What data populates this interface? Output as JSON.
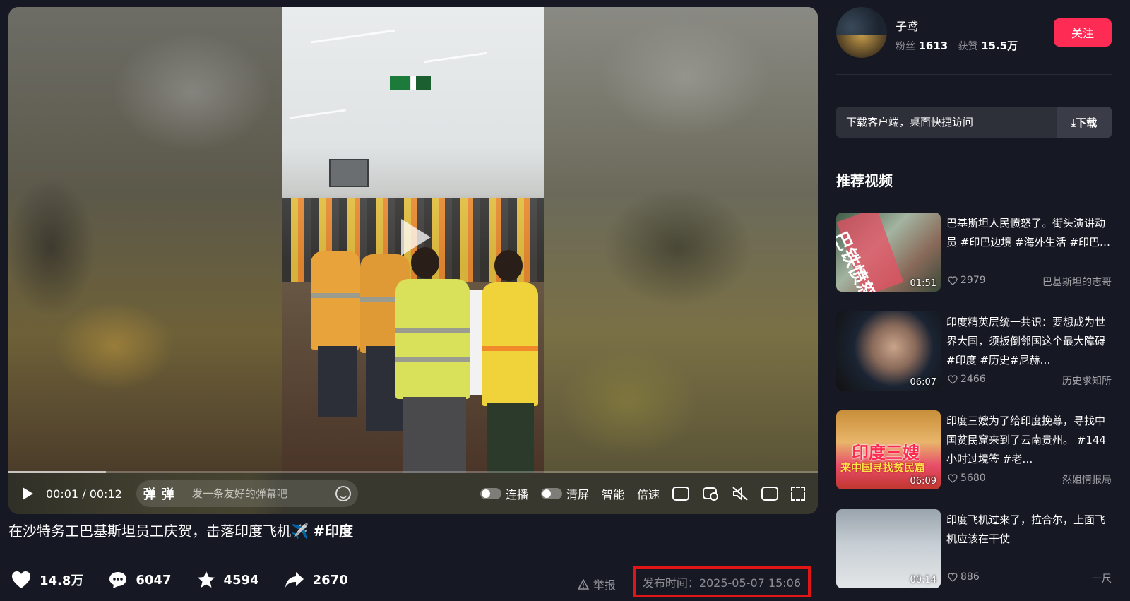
{
  "player": {
    "current_time": "00:01",
    "time_sep": "/",
    "duration": "00:12",
    "progress": 0.12,
    "danmaku_placeholder": "发一条友好的弹幕吧",
    "danmaku_icon_1": "弹",
    "danmaku_icon_2": "弹",
    "controls": {
      "autoplay_label": "连播",
      "clear_label": "清屏",
      "smart_label": "智能",
      "speed_label": "倍速"
    }
  },
  "video": {
    "title": "在沙特务工巴基斯坦员工庆贺，击落印度飞机✈️",
    "hashtag": "#印度",
    "likes": "14.8万",
    "comments": "6047",
    "favorites": "4594",
    "shares": "2670",
    "report_label": "举报",
    "publish_time": "发布时间：2025-05-07 15:06"
  },
  "author": {
    "name": "子鸢",
    "fans_label": "粉丝",
    "fans": "1613",
    "likes_label": "获赞",
    "likes": "15.5万",
    "follow_label": "关注"
  },
  "download": {
    "text": "下载客户端，桌面快捷访问",
    "button": "⤓下载"
  },
  "recommend": {
    "title": "推荐视频",
    "items": [
      {
        "title": "巴基斯坦人民愤怒了。街头演讲动员 #印巴边境 #海外生活 #印巴…",
        "duration": "01:51",
        "likes": "2979",
        "author": "巴基斯坦的志哥",
        "thumb_text": "巴铁愤怒"
      },
      {
        "title": "印度精英层统一共识：要想成为世界大国，须扳倒邻国这个最大障碍 #印度 #历史#尼赫…",
        "duration": "06:07",
        "likes": "2466",
        "author": "历史求知所"
      },
      {
        "title": "印度三嫂为了给印度挽尊，寻找中国贫民窟来到了云南贵州。 #144小时过境签 #老…",
        "duration": "06:09",
        "likes": "5680",
        "author": "然姐情报局",
        "thumb_text": "印度三嫂",
        "thumb_text_2": "来中国寻找贫民窟"
      },
      {
        "title": "印度飞机过来了，拉合尔，上面飞机应该在干仗",
        "duration": "00:14",
        "likes": "886",
        "author": "一尺"
      }
    ]
  },
  "colors": {
    "background": "#161823",
    "accent": "#fe2c55",
    "highlight_box": "#e01515"
  }
}
